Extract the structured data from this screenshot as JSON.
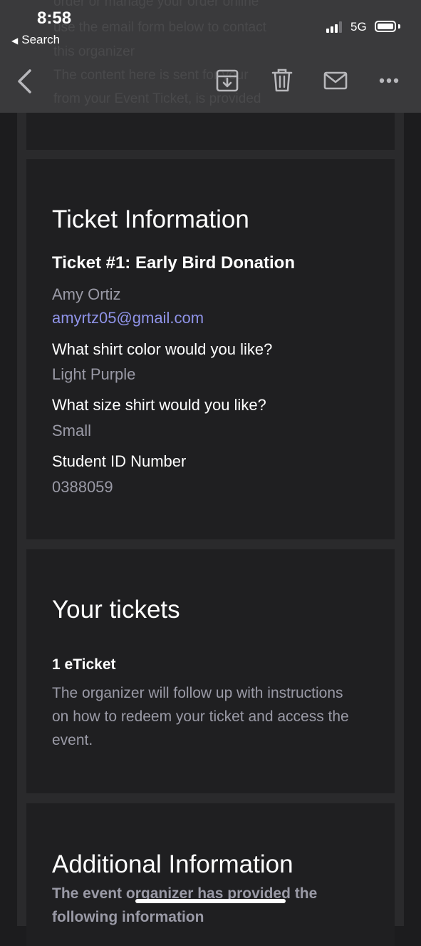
{
  "status_bar": {
    "time": "8:58",
    "back_app": "Search",
    "network": "5G"
  },
  "background_text": [
    "order or manage your order online",
    "use the email form below to contact",
    "this organizer",
    "The content here is sent for your",
    "from your Event Ticket, is provided"
  ],
  "toolbar": {
    "back_icon": "chevron-left-icon",
    "archive_icon": "archive-icon",
    "trash_icon": "trash-icon",
    "mail_icon": "mail-icon",
    "more_icon": "more-icon"
  },
  "ticket_info": {
    "heading": "Ticket Information",
    "ticket_title": "Ticket #1: Early Bird Donation",
    "name": "Amy Ortiz",
    "email": "amyrtz05@gmail.com",
    "q1": "What shirt color would you like?",
    "a1": "Light Purple",
    "q2": "What size shirt would you like?",
    "a2": "Small",
    "q3": "Student ID Number",
    "a3": "0388059"
  },
  "your_tickets": {
    "heading": "Your tickets",
    "count_label": "1 eTicket",
    "description": "The organizer will follow up with instructions on how to redeem your ticket and access the event."
  },
  "additional_info": {
    "heading": "Additional Information",
    "text": "The event organizer has provided the following information"
  },
  "colors": {
    "background": "#1c1c1e",
    "card": "#1f1f21",
    "header": "#3a3a3c",
    "muted_text": "#9a9aa6",
    "link": "#8f93e8"
  }
}
